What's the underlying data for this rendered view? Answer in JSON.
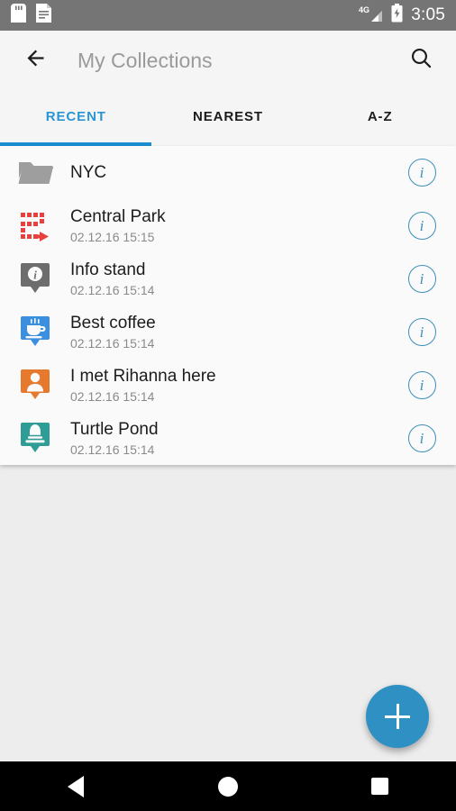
{
  "statusbar": {
    "time": "3:05",
    "network_label": "4G",
    "icons": [
      "sd-card-icon",
      "document-icon",
      "signal-4g-icon",
      "battery-charging-icon"
    ]
  },
  "toolbar": {
    "back_icon": "arrow-left-icon",
    "title": "My Collections",
    "search_icon": "search-icon"
  },
  "tabs": {
    "items": [
      {
        "label": "RECENT",
        "active": true
      },
      {
        "label": "NEAREST",
        "active": false
      },
      {
        "label": "A-Z",
        "active": false
      }
    ],
    "indicator_color": "#1a8fd0",
    "active_text_color": "#2a95d5"
  },
  "list": {
    "info_glyph": "i",
    "items": [
      {
        "title": "NYC",
        "subtitle": "",
        "icon": "folder-icon",
        "icon_color": "#9e9e9e",
        "info_label": "info-button"
      },
      {
        "title": "Central Park",
        "subtitle": "02.12.16 15:15",
        "icon": "route-track-icon",
        "icon_color": "#e8413d",
        "info_label": "info-button"
      },
      {
        "title": "Info stand",
        "subtitle": "02.12.16 15:14",
        "icon": "map-pin-info-icon",
        "icon_color": "#6d6d6d",
        "info_label": "info-button"
      },
      {
        "title": "Best coffee",
        "subtitle": "02.12.16 15:14",
        "icon": "map-pin-coffee-icon",
        "icon_color": "#3b8fdf",
        "info_label": "info-button"
      },
      {
        "title": "I met Rihanna here",
        "subtitle": "02.12.16 15:14",
        "icon": "map-pin-person-icon",
        "icon_color": "#e57a2e",
        "info_label": "info-button"
      },
      {
        "title": "Turtle Pond",
        "subtitle": "02.12.16 15:14",
        "icon": "map-pin-monument-icon",
        "icon_color": "#2f9c96",
        "info_label": "info-button"
      }
    ]
  },
  "fab": {
    "label": "+",
    "icon": "plus-icon",
    "color": "#2f90c3"
  },
  "navbar": {
    "back_icon": "nav-back-icon",
    "home_icon": "nav-home-icon",
    "recents_icon": "nav-recents-icon"
  }
}
